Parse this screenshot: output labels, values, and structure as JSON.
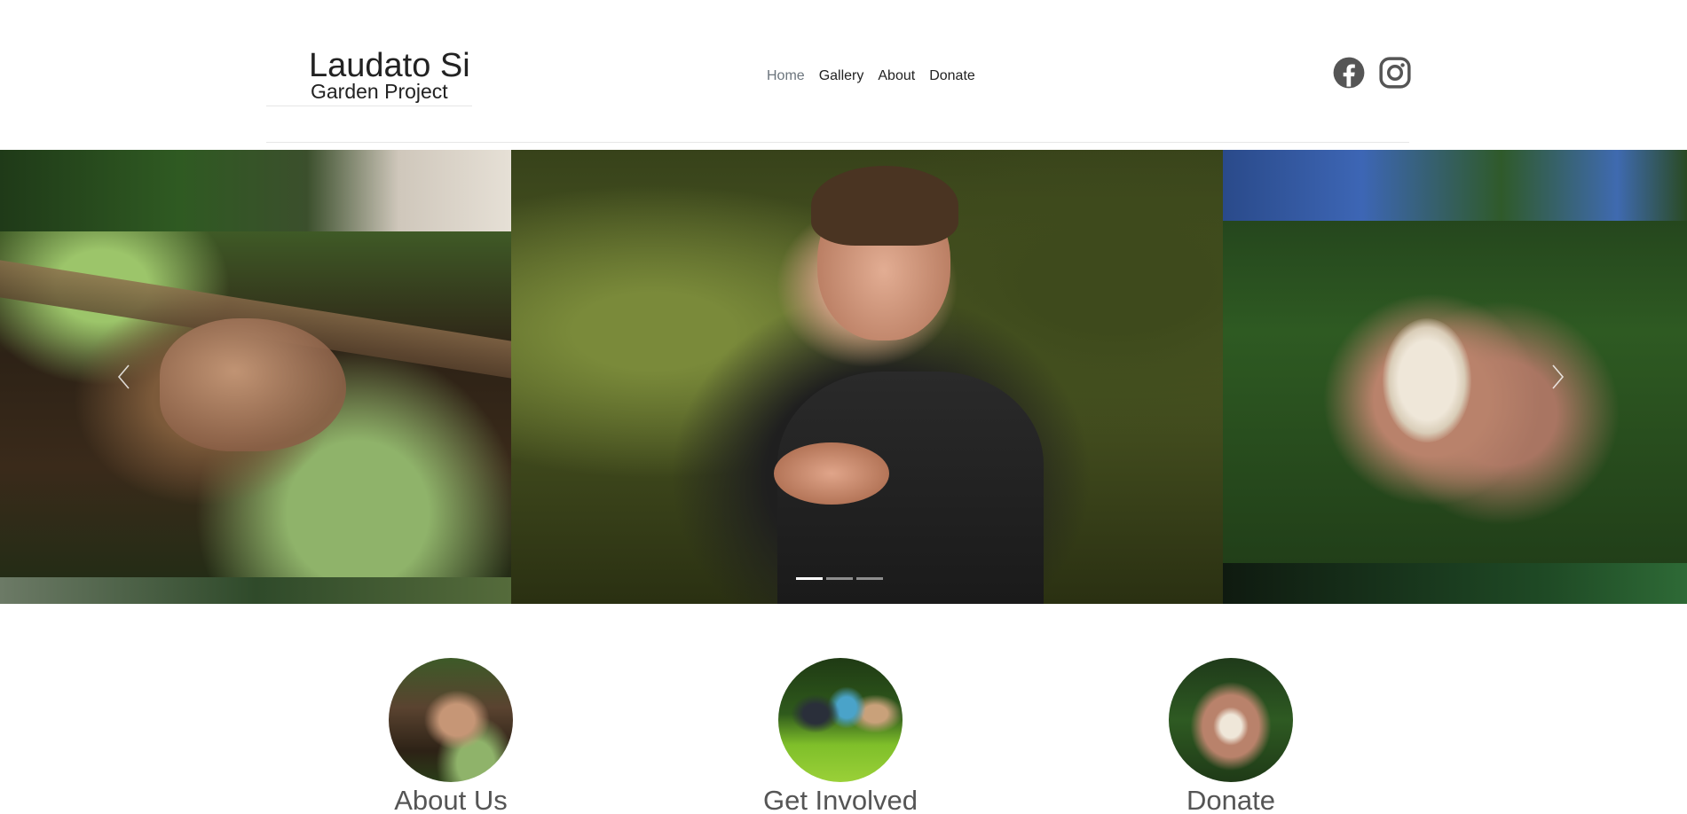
{
  "brand": {
    "title": "Laudato Si",
    "subtitle": "Garden Project"
  },
  "nav": {
    "items": [
      {
        "label": "Home",
        "active": true
      },
      {
        "label": "Gallery",
        "active": false
      },
      {
        "label": "About",
        "active": false
      },
      {
        "label": "Donate",
        "active": false
      }
    ]
  },
  "social": {
    "icons": [
      "facebook-icon",
      "instagram-icon"
    ],
    "color": "#555555"
  },
  "carousel": {
    "slide_count": 3,
    "active_index": 0,
    "icons": [
      "chevron-left-icon",
      "chevron-right-icon"
    ]
  },
  "features": [
    {
      "label": "About Us"
    },
    {
      "label": "Get Involved"
    },
    {
      "label": "Donate"
    }
  ],
  "colors": {
    "text": "#222222",
    "nav_active": "#6c757d",
    "feature_label": "#555555",
    "divider": "#e6e6e6"
  }
}
